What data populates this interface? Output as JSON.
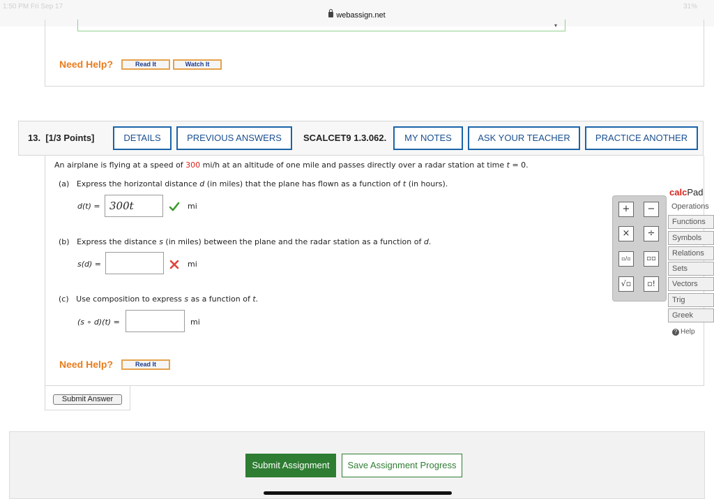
{
  "status_bar": {
    "time": "1:50 PM  Fri Sep 17",
    "battery": "31%"
  },
  "browser": {
    "url": "webassign.net"
  },
  "prev_question": {
    "need_help_label": "Need Help?",
    "read_it": "Read It",
    "watch_it": "Watch It"
  },
  "question": {
    "number": "13.",
    "points": "[1/3 Points]",
    "code": "SCALCET9 1.3.062.",
    "buttons": {
      "details": "DETAILS",
      "previous_answers": "PREVIOUS ANSWERS",
      "my_notes": "MY NOTES",
      "ask_teacher": "ASK YOUR TEACHER",
      "practice_another": "PRACTICE ANOTHER"
    },
    "intro": {
      "pre": "An airplane is flying at a speed of ",
      "speed": "300",
      "mid": " mi/h at an altitude of one mile and passes directly over a radar station at time ",
      "var_t": "t",
      "post": " = 0."
    },
    "part_a": {
      "label": "(a)",
      "text_pre": "Express the horizontal distance ",
      "var_d": "d",
      "text_mid": " (in miles) that the plane has flown as a function of ",
      "var_t": "t",
      "text_post": " (in hours).",
      "lhs": "d(t)  =",
      "answer": "300t",
      "unit": "mi",
      "status": "correct"
    },
    "part_b": {
      "label": "(b)",
      "text_pre": "Express the distance ",
      "var_s": "s",
      "text_mid": " (in miles) between the plane and the radar station as a function of ",
      "var_d": "d",
      "text_post": ".",
      "lhs": "s(d)  =",
      "answer": "",
      "unit": "mi",
      "status": "incorrect"
    },
    "part_c": {
      "label": "(c)",
      "text_pre": "Use composition to express ",
      "var_s": "s",
      "text_mid": " as a function of ",
      "var_t": "t",
      "text_post": ".",
      "lhs": "(s ∘ d)(t)  =",
      "answer": "",
      "unit": "mi"
    },
    "need_help_label": "Need Help?",
    "read_it": "Read It",
    "submit_answer": "Submit Answer"
  },
  "calcpad": {
    "title_part1": "calc",
    "title_part2": "Pad",
    "keys": [
      "+",
      "−",
      "×",
      "÷",
      "▫/▫",
      "▫▫",
      "√▫",
      "▫!"
    ],
    "categories": [
      "Operations",
      "Functions",
      "Symbols",
      "Relations",
      "Sets",
      "Vectors",
      "Trig",
      "Greek"
    ],
    "help": "Help"
  },
  "footer": {
    "submit_assignment": "Submit Assignment",
    "save_progress": "Save Assignment Progress"
  }
}
